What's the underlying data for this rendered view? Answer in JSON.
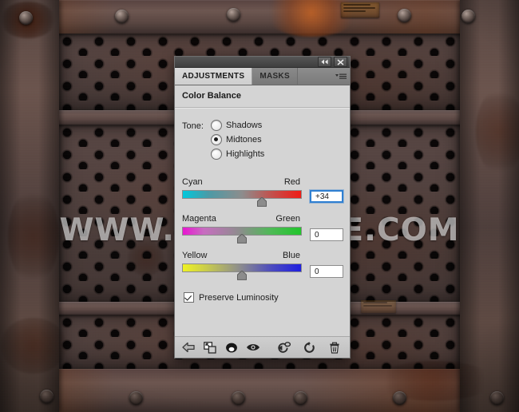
{
  "background": {
    "watermark_text": "WWW.PSD-DUDE.COM",
    "description": "rusty perforated metal plate with rivets",
    "colors": {
      "metal": "#554441",
      "rust": "#a44a18",
      "hole": "#090606"
    }
  },
  "panel": {
    "titlebar": {
      "collapse_icon": "double-left-arrow-icon",
      "close_icon": "close-icon"
    },
    "tabs": [
      {
        "label": "ADJUSTMENTS",
        "active": true
      },
      {
        "label": "MASKS",
        "active": false
      }
    ],
    "menu_icon": "panel-menu-icon",
    "section_title": "Color Balance",
    "tone": {
      "label": "Tone:",
      "options": [
        {
          "label": "Shadows",
          "selected": false
        },
        {
          "label": "Midtones",
          "selected": true
        },
        {
          "label": "Highlights",
          "selected": false
        }
      ]
    },
    "sliders": [
      {
        "left_label": "Cyan",
        "right_label": "Red",
        "value": "+34",
        "position_pct": 67,
        "focused": true,
        "gradient": "cyan-to-red"
      },
      {
        "left_label": "Magenta",
        "right_label": "Green",
        "value": "0",
        "position_pct": 50,
        "focused": false,
        "gradient": "magenta-to-green"
      },
      {
        "left_label": "Yellow",
        "right_label": "Blue",
        "value": "0",
        "position_pct": 50,
        "focused": false,
        "gradient": "yellow-to-blue"
      }
    ],
    "preserve_luminosity": {
      "label": "Preserve Luminosity",
      "checked": true
    },
    "footer_icons": [
      "return-to-adjustment-list-icon",
      "clip-to-layer-icon",
      "toggle-layer-mask-icon",
      "toggle-layer-visibility-icon",
      "reset-previous-state-icon",
      "reset-adjustment-icon",
      "delete-adjustment-layer-icon"
    ],
    "accent_color": "#2f7fd1"
  }
}
